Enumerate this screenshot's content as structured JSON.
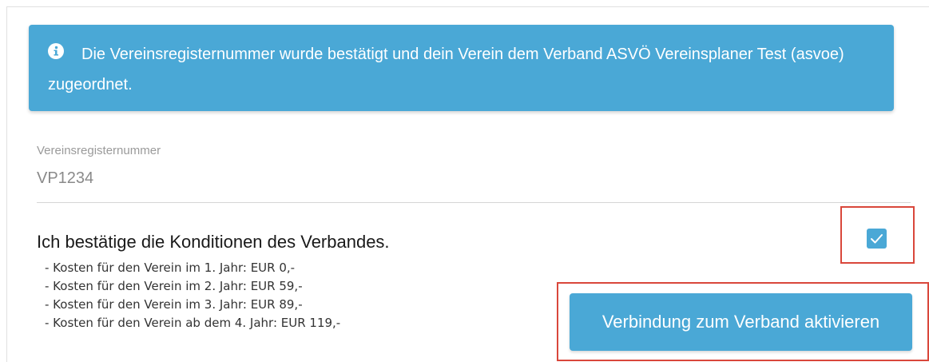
{
  "alert": {
    "icon": "info-icon",
    "message": "Die Vereinsregisternummer wurde bestätigt und dein Verein dem Verband ASVÖ Vereinsplaner Test (asvoe) zugeordnet.",
    "color": "#4aa8d6"
  },
  "registration_field": {
    "label": "Vereinsregisternummer",
    "value": "VP1234"
  },
  "conditions": {
    "title": "Ich bestätige die Konditionen des Verbandes.",
    "costs": [
      "- Kosten für den Verein im 1. Jahr: EUR 0,-",
      "- Kosten für den Verein im 2. Jahr: EUR 59,-",
      "- Kosten für den Verein im 3. Jahr: EUR 89,-",
      "- Kosten für den Verein ab dem 4. Jahr: EUR 119,-"
    ],
    "checkbox_checked": true,
    "checkbox_icon": "checkmark-icon"
  },
  "actions": {
    "activate_label": "Verbindung zum Verband aktivieren"
  },
  "colors": {
    "accent": "#4aa8d6",
    "highlight": "#d9473b"
  }
}
